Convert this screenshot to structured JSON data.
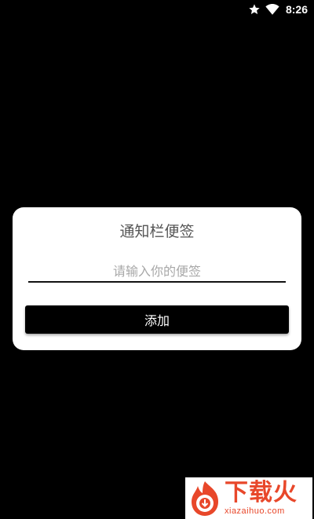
{
  "status_bar": {
    "time": "8:26",
    "icons": [
      "star-icon",
      "wifi-icon"
    ]
  },
  "dialog": {
    "title": "通知栏便签",
    "input": {
      "value": "",
      "placeholder": "请输入你的便签"
    },
    "add_button_label": "添加"
  },
  "watermark": {
    "title": "下载火",
    "url": "xiazaihuo.com",
    "color": "#e8472a"
  },
  "colors": {
    "background": "#000000",
    "dialog_bg": "#ffffff",
    "button_bg": "#000000",
    "title_text": "#555555",
    "placeholder_text": "#a8a8a8"
  }
}
